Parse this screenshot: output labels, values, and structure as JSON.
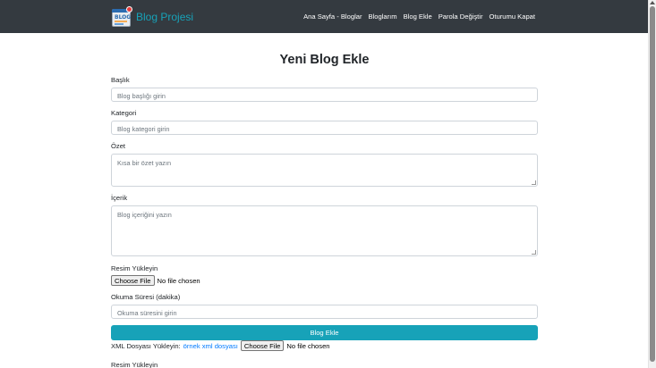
{
  "navbar": {
    "brand": "Blog Projesi",
    "logo_text": "BLOG",
    "links": [
      "Ana Sayfa - Bloglar",
      "Bloglarım",
      "Blog Ekle",
      "Parola Değiştir",
      "Oturumu Kapat"
    ]
  },
  "form": {
    "title": "Yeni Blog Ekle",
    "title_field": {
      "label": "Başlık",
      "placeholder": "Blog başlığı girin"
    },
    "category_field": {
      "label": "Kategori",
      "placeholder": "Blog kategori girin"
    },
    "summary_field": {
      "label": "Özet",
      "placeholder": "Kısa bir özet yazın"
    },
    "content_field": {
      "label": "İçerik",
      "placeholder": "Blog içeriğini yazın"
    },
    "image_field": {
      "label": "Resim Yükleyin",
      "button": "Choose File",
      "status": "No file chosen"
    },
    "reading_time_field": {
      "label": "Okuma Süresi (dakika)",
      "placeholder": "Okuma süresini girin"
    },
    "submit_label": "Blog Ekle",
    "xml_upload": {
      "label": "XML Dosyası Yükleyin:",
      "link": "örnek xml dosyası",
      "button": "Choose File",
      "status": "No file chosen"
    },
    "image_field_2": {
      "label": "Resim Yükleyin"
    }
  },
  "colors": {
    "navbar_bg": "#343a40",
    "accent": "#17a2b8",
    "link": "#007bff"
  }
}
